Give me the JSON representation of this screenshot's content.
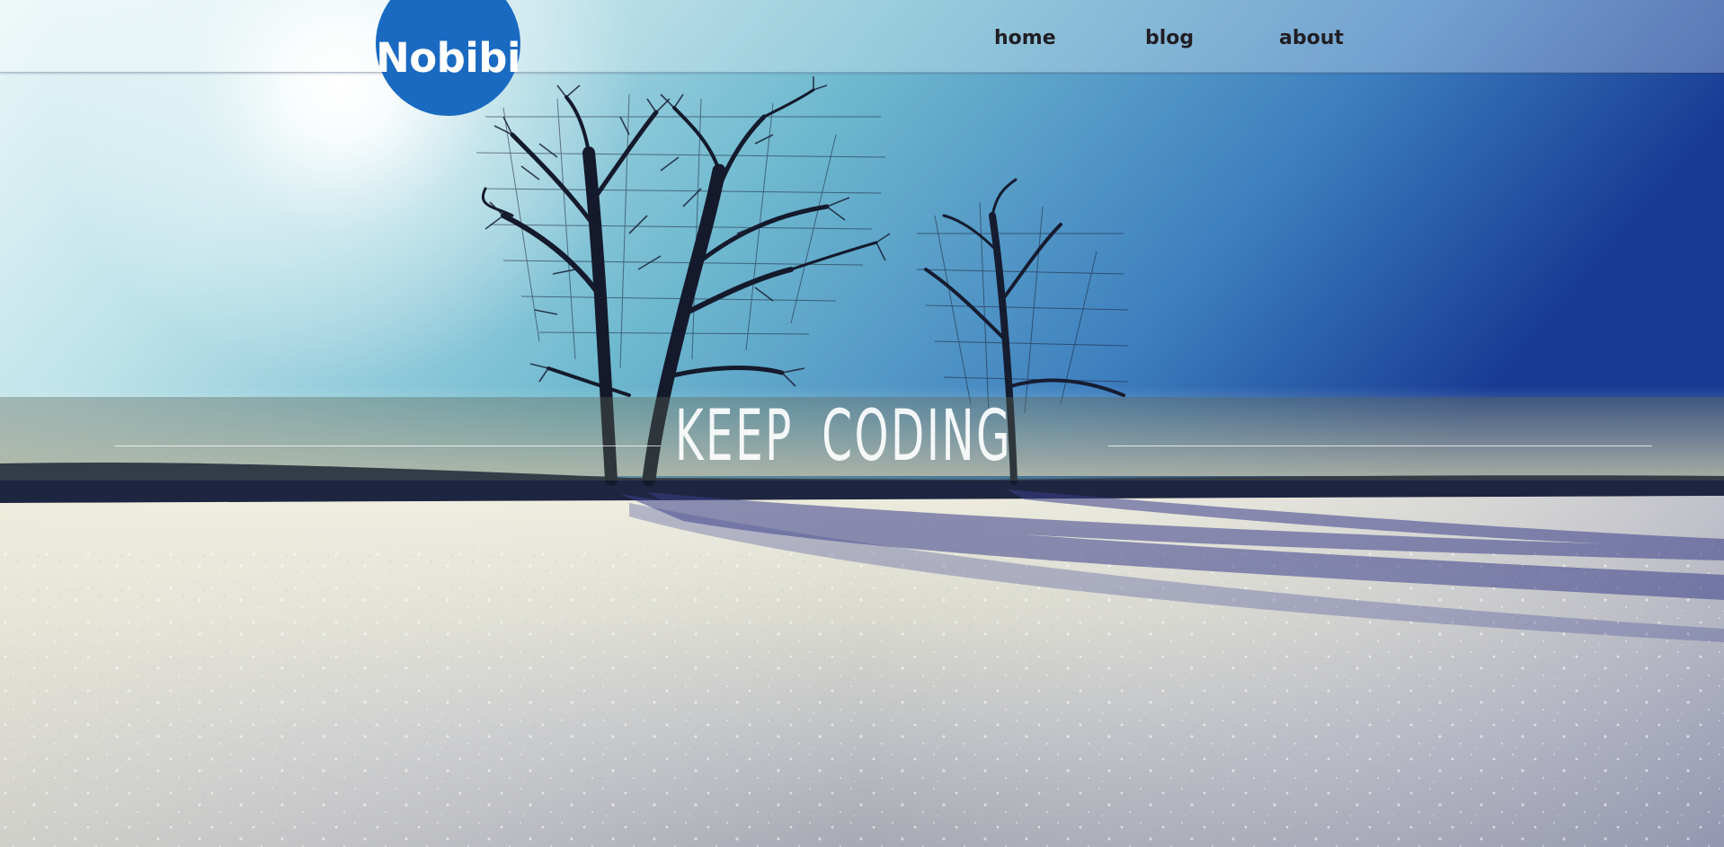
{
  "brand": {
    "logo_text": "Nobibi",
    "logo_color": "#1a6ac2"
  },
  "nav": {
    "items": [
      {
        "label": "home"
      },
      {
        "label": "blog"
      },
      {
        "label": "about"
      }
    ]
  },
  "hero": {
    "tagline": "KEEP CODING",
    "background": "winter-landscape-trees-snow"
  }
}
